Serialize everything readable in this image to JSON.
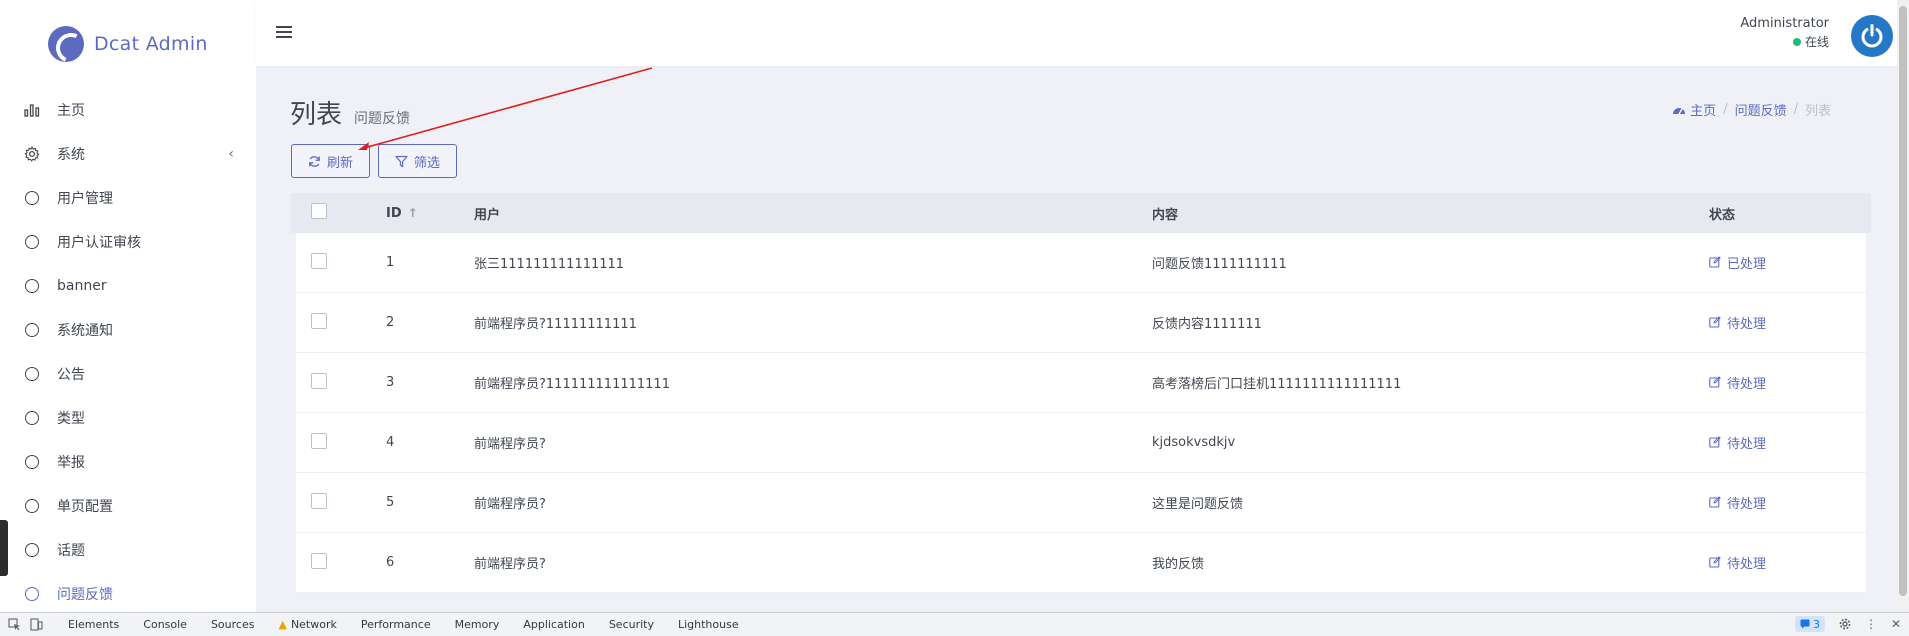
{
  "brand": {
    "name": "Dcat Admin"
  },
  "sidebar": {
    "items": [
      {
        "label": "主页",
        "icon": "bar-chart-icon"
      },
      {
        "label": "系统",
        "icon": "gear-icon",
        "arrow": "‹"
      },
      {
        "label": "用户管理",
        "icon": "circle-icon"
      },
      {
        "label": "用户认证审核",
        "icon": "circle-icon"
      },
      {
        "label": "banner",
        "icon": "circle-icon"
      },
      {
        "label": "系统通知",
        "icon": "circle-icon"
      },
      {
        "label": "公告",
        "icon": "circle-icon"
      },
      {
        "label": "类型",
        "icon": "circle-icon"
      },
      {
        "label": "举报",
        "icon": "circle-icon"
      },
      {
        "label": "单页配置",
        "icon": "circle-icon"
      },
      {
        "label": "话题",
        "icon": "circle-icon"
      },
      {
        "label": "问题反馈",
        "icon": "circle-icon",
        "active": true
      }
    ]
  },
  "header": {
    "user_name": "Administrator",
    "user_status": "在线"
  },
  "page": {
    "title": "列表",
    "subtitle": "问题反馈"
  },
  "breadcrumb": {
    "home": "主页",
    "section": "问题反馈",
    "current": "列表"
  },
  "toolbar": {
    "refresh_label": "刷新",
    "filter_label": "筛选"
  },
  "table": {
    "columns": {
      "id": "ID",
      "user": "用户",
      "content": "内容",
      "status": "状态"
    },
    "rows": [
      {
        "id": "1",
        "user": "张三111111111111111",
        "content": "问题反馈1111111111",
        "status": "已处理"
      },
      {
        "id": "2",
        "user": "前端程序员?11111111111",
        "content": "反馈内容1111111",
        "status": "待处理"
      },
      {
        "id": "3",
        "user": "前端程序员?111111111111111",
        "content": "高考落榜后门口挂机1111111111111111",
        "status": "待处理"
      },
      {
        "id": "4",
        "user": "前端程序员?",
        "content": "kjdsokvsdkjv",
        "status": "待处理"
      },
      {
        "id": "5",
        "user": "前端程序员?",
        "content": "这里是问题反馈",
        "status": "待处理"
      },
      {
        "id": "6",
        "user": "前端程序员?",
        "content": "我的反馈",
        "status": "待处理"
      }
    ]
  },
  "devtools": {
    "tabs": [
      "Elements",
      "Console",
      "Sources",
      "Network",
      "Performance",
      "Memory",
      "Application",
      "Security",
      "Lighthouse"
    ],
    "message_count": "3"
  },
  "colors": {
    "accent": "#5c6bc0",
    "online": "#21b978",
    "avatar": "#2478c7",
    "annotation_arrow": "#e02020"
  }
}
